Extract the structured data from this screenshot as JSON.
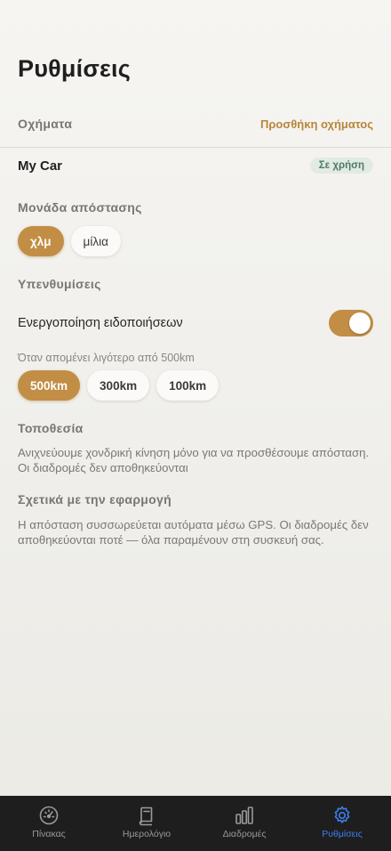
{
  "header": {
    "title": "Ρυθμίσεις"
  },
  "vehicles": {
    "section_label": "Οχήματα",
    "add_label": "Προσθήκη οχήματος",
    "items": [
      {
        "name": "My Car",
        "badge": "Σε χρήση"
      }
    ]
  },
  "distance_unit": {
    "section_label": "Μονάδα απόστασης",
    "options": [
      "χλμ",
      "μίλια"
    ],
    "selected": "χλμ"
  },
  "reminders": {
    "section_label": "Υπενθυμίσεις",
    "notifications_label": "Ενεργοποίηση ειδοποιήσεων",
    "notifications_enabled": true,
    "threshold_caption": "Όταν απομένει λιγότερο από 500km",
    "threshold_options": [
      "500km",
      "300km",
      "100km"
    ],
    "threshold_selected": "500km"
  },
  "location": {
    "section_label": "Τοποθεσία",
    "description": "Ανιχνεύουμε χονδρική κίνηση μόνο για να προσθέσουμε απόσταση. Οι διαδρομές δεν αποθηκεύονται"
  },
  "about": {
    "section_label": "Σχετικά με την εφαρμογή",
    "description": "Η απόσταση συσσωρεύεται αυτόματα μέσω GPS. Οι διαδρομές δεν αποθηκεύονται ποτέ — όλα παραμένουν στη συσκευή σας."
  },
  "tabbar": {
    "tabs": [
      {
        "label": "Πίνακας",
        "icon": "gauge-icon"
      },
      {
        "label": "Ημερολόγιο",
        "icon": "book-icon"
      },
      {
        "label": "Διαδρομές",
        "icon": "bars-icon"
      },
      {
        "label": "Ρυθμίσεις",
        "icon": "gear-icon"
      }
    ],
    "active": "Ρυθμίσεις"
  },
  "colors": {
    "accent": "#c28e45",
    "link": "#b8863a",
    "badge_text": "#4e7a63",
    "badge_bg": "#e1ebe4",
    "tab_active": "#3d7ef0",
    "tabbar_bg": "#1e1e1e"
  }
}
